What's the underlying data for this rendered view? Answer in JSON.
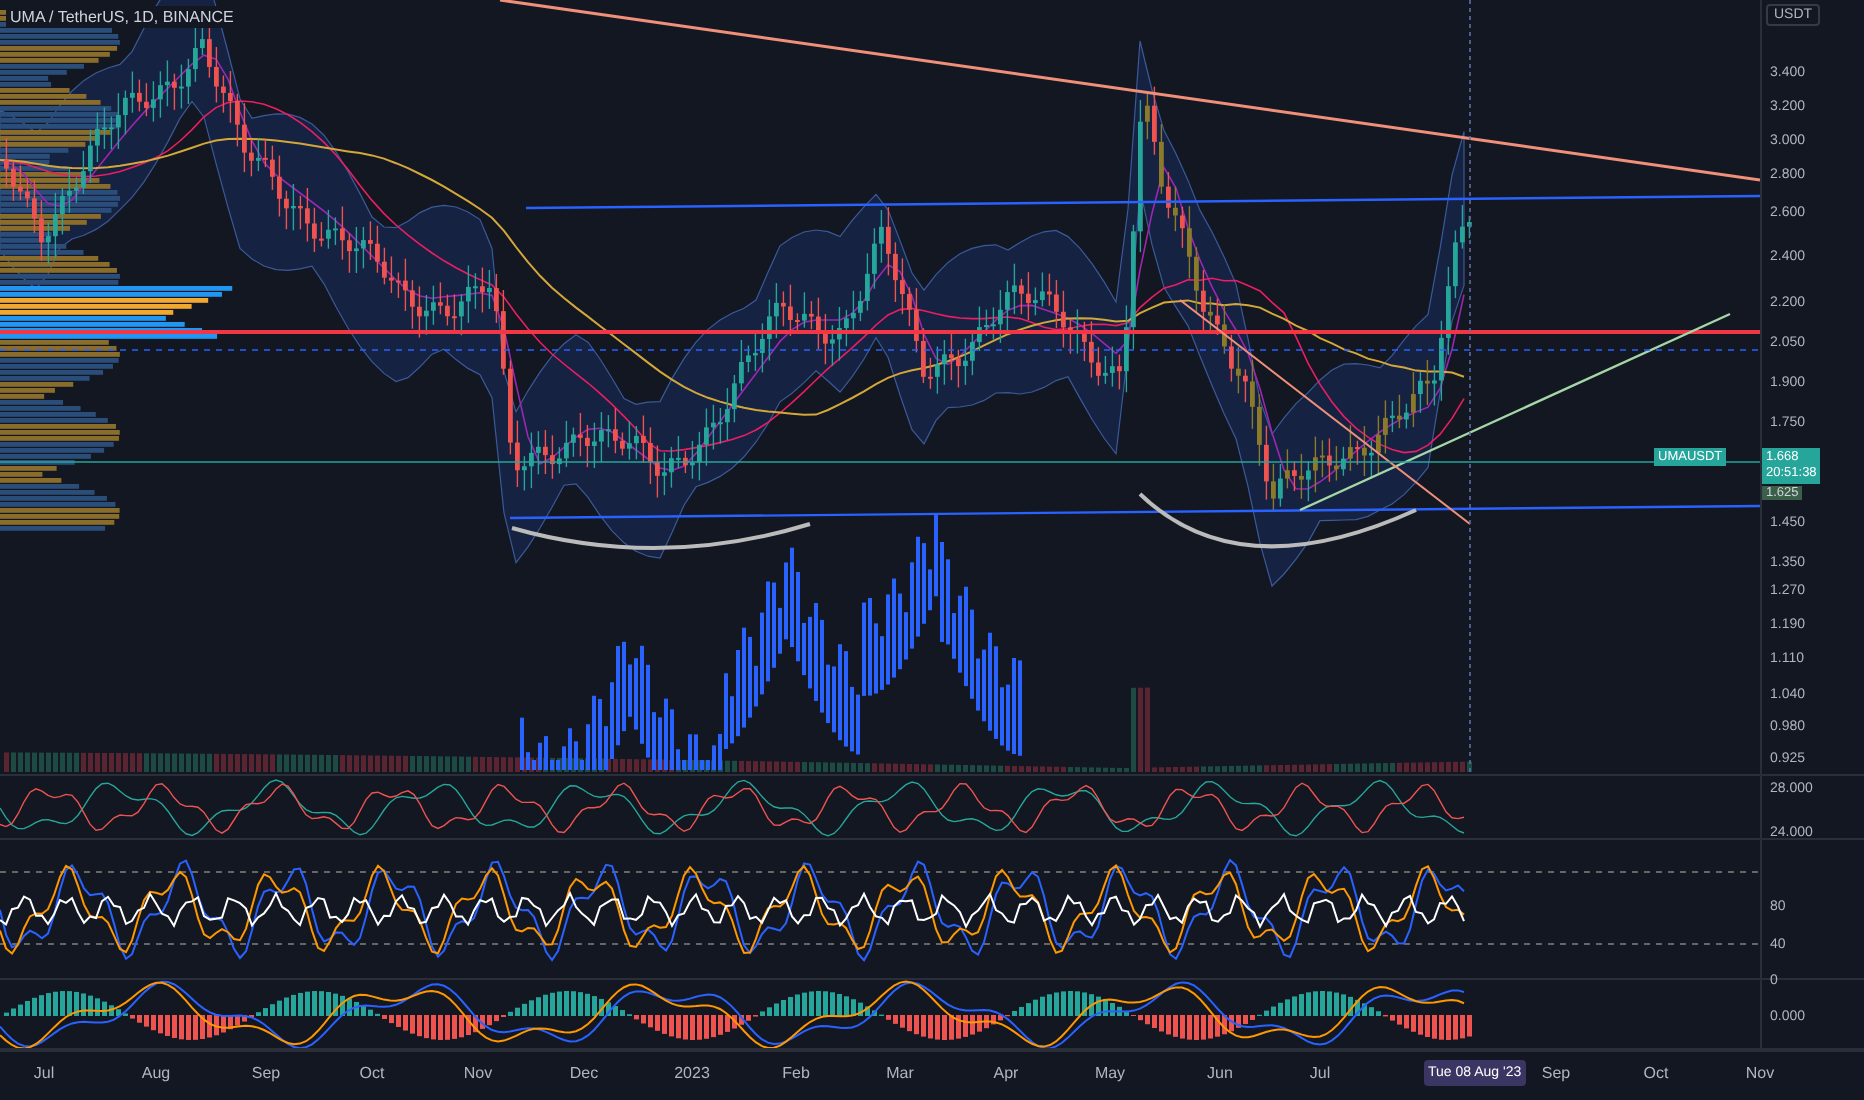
{
  "chart": {
    "title": "UMA / TetherUS, 1D, BINANCE",
    "currency": "USDT",
    "price_labels": [
      "3.400",
      "3.200",
      "3.000",
      "2.800",
      "2.600",
      "2.400",
      "2.200",
      "2.050",
      "1.900",
      "1.750",
      "1.450",
      "1.350",
      "1.270",
      "1.190",
      "1.110",
      "1.040",
      "0.980",
      "0.925"
    ],
    "symbol_tag": "UMAUSDT",
    "last_price": "1.668",
    "countdown": "20:51:38",
    "marker_price": "1.625"
  },
  "panes": [
    {
      "labels": [
        "28.000",
        "24.000"
      ]
    },
    {
      "labels": [
        "80",
        "40",
        "0"
      ]
    },
    {
      "labels": [
        "0.000"
      ]
    }
  ],
  "time_axis": {
    "labels": [
      "Jul",
      "Aug",
      "Sep",
      "Oct",
      "Nov",
      "Dec",
      "2023",
      "Feb",
      "Mar",
      "Apr",
      "May",
      "Jun",
      "Jul"
    ],
    "cursor_date": "Tue 08 Aug '23",
    "future_labels": [
      "Sep",
      "Oct",
      "Nov"
    ]
  }
}
